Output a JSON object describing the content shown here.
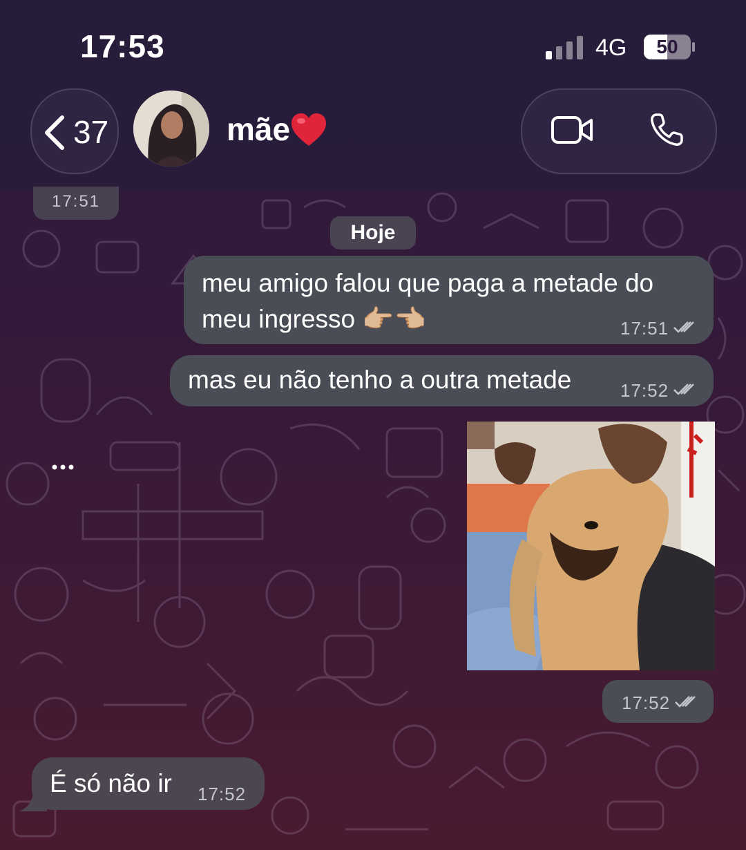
{
  "status_bar": {
    "time": "17:53",
    "network": "4G",
    "battery": "50",
    "battery_level": 0.5
  },
  "header": {
    "back_count": "37",
    "contact_name": "mãe",
    "name_emoji": "red-heart-icon",
    "actions": [
      "video-call-icon",
      "voice-call-icon"
    ]
  },
  "chat": {
    "previous_time": "17:51",
    "day_divider": "Hoje",
    "messages": [
      {
        "direction": "outgoing",
        "lines": [
          "meu amigo falou que paga a metade do",
          "meu ingresso 👉🏼👈🏼"
        ],
        "time": "17:51",
        "status": "read"
      },
      {
        "direction": "outgoing",
        "lines": [
          "mas eu não tenho a outra metade"
        ],
        "time": "17:52",
        "status": "read"
      },
      {
        "direction": "outgoing",
        "media": "puppy photo",
        "time": "17:52",
        "status": "read"
      },
      {
        "direction": "incoming",
        "lines": [
          "É só não ir"
        ],
        "time": "17:52"
      }
    ]
  },
  "colors": {
    "outgoing_bubble": "#4a4d55",
    "incoming_bubble": "#4c4650",
    "header_bg": "#281c3a"
  }
}
